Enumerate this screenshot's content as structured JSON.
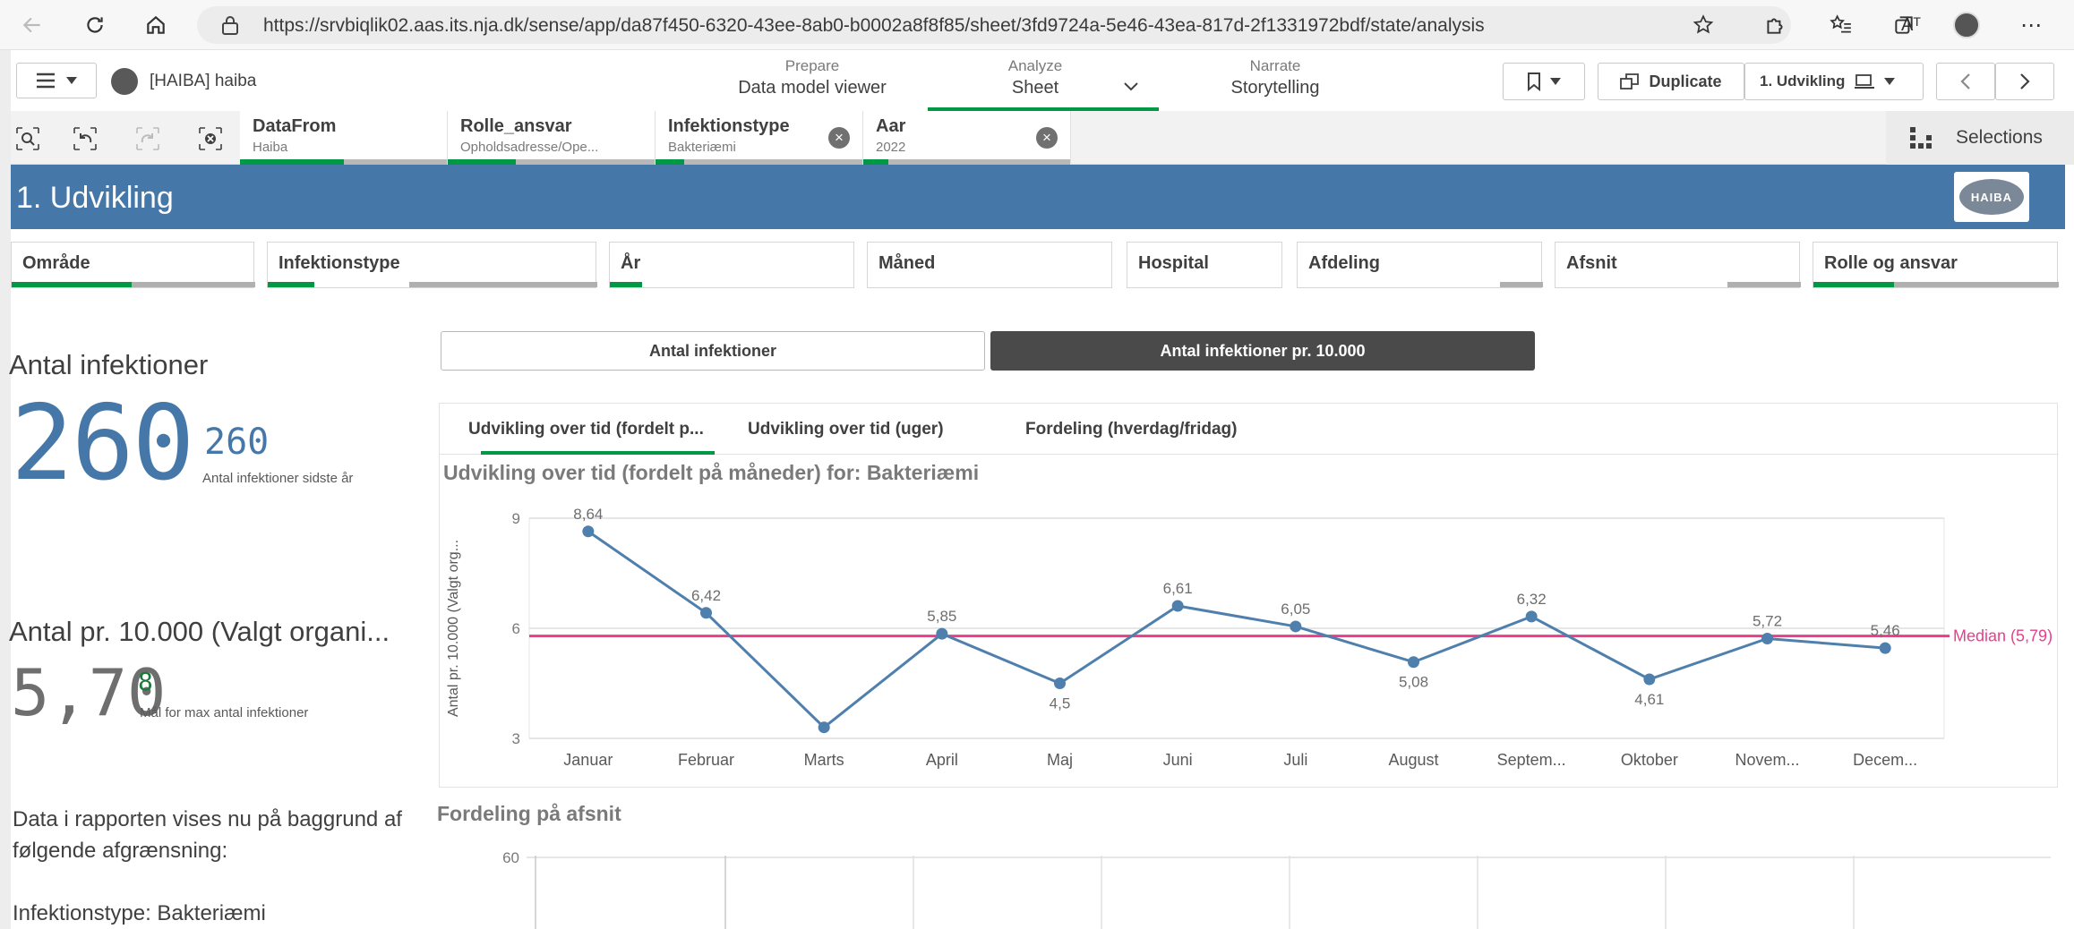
{
  "browser": {
    "url": "https://srvbiqlik02.aas.its.nja.dk/sense/app/da87f450-6320-43ee-8ab0-b0002a8f8f85/sheet/3fd9724a-5e46-43ea-817d-2f1331972bdf/state/analysis",
    "read_aloud_label": "Aᵀ"
  },
  "toolbar": {
    "app_name": "[HAIBA] haiba",
    "modes": [
      {
        "top": "Prepare",
        "bottom": "Data model viewer"
      },
      {
        "top": "Analyze",
        "bottom": "Sheet"
      },
      {
        "top": "Narrate",
        "bottom": "Storytelling"
      }
    ],
    "duplicate_label": "Duplicate",
    "sheet_selector": "1. Udvikling"
  },
  "selections": {
    "pills": [
      {
        "title": "DataFrom",
        "sub": "Haiba",
        "green": 0.5
      },
      {
        "title": "Rolle_ansvar",
        "sub": "Opholdsadresse/Ope...",
        "green": 0.33
      },
      {
        "title": "Infektionstype",
        "sub": "Bakteriæmi",
        "green": 0.14
      },
      {
        "title": "Aar",
        "sub": "2022",
        "green": 0.12
      }
    ],
    "close_glyph": "×",
    "selections_label": "Selections"
  },
  "sheet": {
    "title": "1. Udvikling",
    "logo_text": "HAIBA"
  },
  "filters": [
    {
      "label": "Område"
    },
    {
      "label": "Infektionstype"
    },
    {
      "label": "År"
    },
    {
      "label": "Måned"
    },
    {
      "label": "Hospital"
    },
    {
      "label": "Afdeling"
    },
    {
      "label": "Afsnit"
    },
    {
      "label": "Rolle og ansvar"
    }
  ],
  "kpi": {
    "title1": "Antal infektioner",
    "value1": "260",
    "value1_small": "260",
    "caption1": "Antal infektioner sidste år",
    "title2": "Antal pr. 10.000 (Valgt organi...",
    "value2": "5,70",
    "value2_small": "8",
    "caption2": "Mål for max antal infektioner"
  },
  "info": {
    "line1": "Data i rapporten vises nu på baggrund af",
    "line2": "følgende afgrænsning:",
    "line3": "Infektionstype: Bakteriæmi"
  },
  "buttons": {
    "count": "Antal infektioner",
    "per10000": "Antal infektioner pr. 10.000"
  },
  "chart_tabs": [
    "Udvikling over tid (fordelt p...",
    "Udvikling over tid (uger)",
    "Fordeling (hverdag/fridag)"
  ],
  "chart_title": "Udvikling over tid (fordelt på måneder) for: Bakteriæmi",
  "chart_data": {
    "type": "line",
    "categories": [
      "Januar",
      "Februar",
      "Marts",
      "April",
      "Maj",
      "Juni",
      "Juli",
      "August",
      "Septem...",
      "Oktober",
      "Novem...",
      "Decem..."
    ],
    "values": [
      8.64,
      6.42,
      3.3,
      5.85,
      4.5,
      6.61,
      6.05,
      5.08,
      6.32,
      4.61,
      5.72,
      5.46
    ],
    "labels": [
      "8,64",
      "6,42",
      "",
      "5,85",
      "4,5",
      "6,61",
      "6,05",
      "5,08",
      "6,32",
      "4,61",
      "5,72",
      "5,46"
    ],
    "ylabel": "Antal pr. 10.000 (Valgt org...",
    "yticks": [
      "3",
      "6",
      "9"
    ],
    "ytick_values": [
      3,
      6,
      9
    ],
    "ylim": [
      3,
      9
    ],
    "reference_line": {
      "value": 5.79,
      "label": "Median (5,79)",
      "color": "#e83e8c"
    },
    "line_color": "#4f7fad",
    "grid": true
  },
  "distribution": {
    "title": "Fordeling på afsnit",
    "ytick": "60"
  },
  "colors": {
    "accent_green": "#009845",
    "header_blue": "#4577a9",
    "button_dark": "#4a4a4a"
  }
}
